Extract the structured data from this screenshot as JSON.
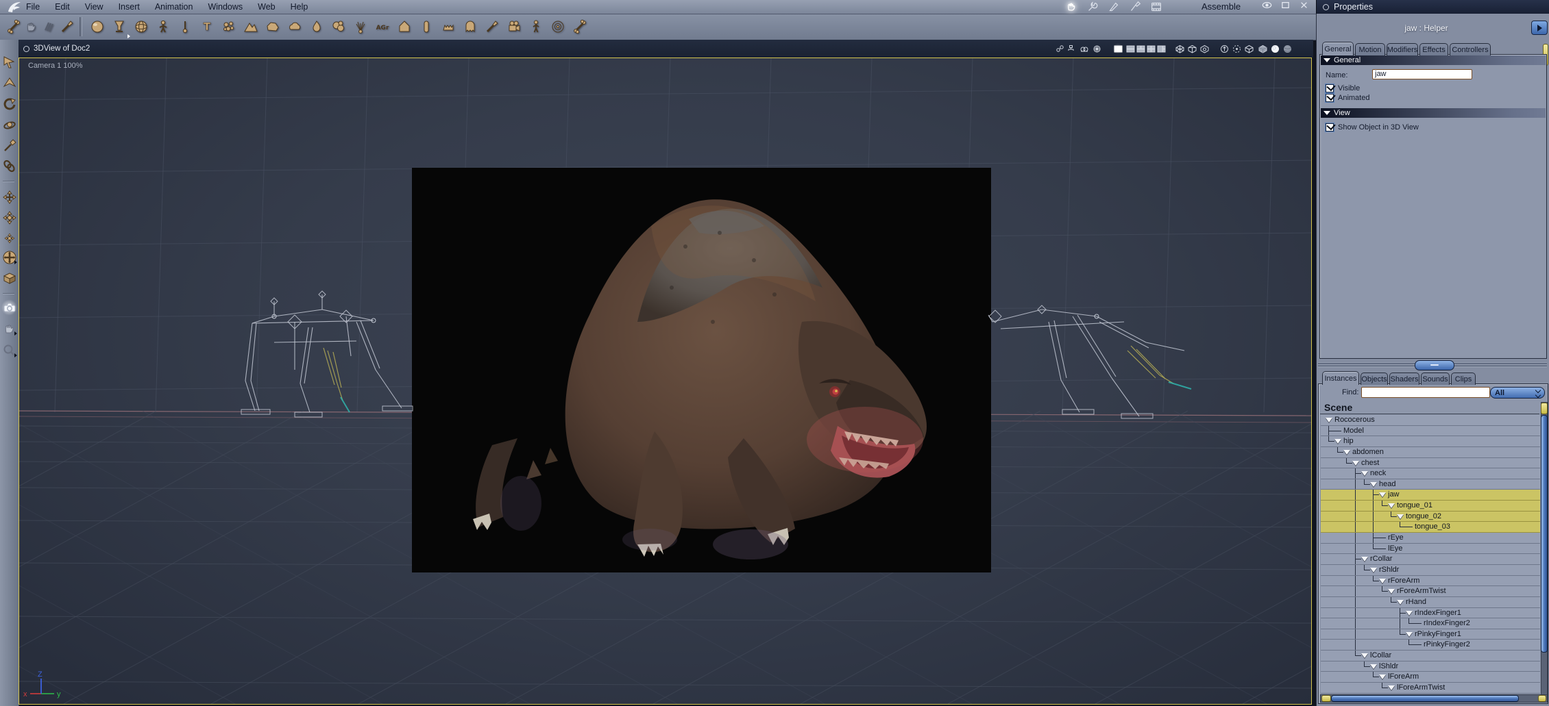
{
  "menubar": {
    "items": [
      "File",
      "Edit",
      "View",
      "Insert",
      "Animation",
      "Windows",
      "Web",
      "Help"
    ],
    "mode_label": "Assemble",
    "mode_icons": [
      "hand-mode-icon",
      "wrench-mode-icon",
      "vertex-pen-mode-icon",
      "brush-mode-icon",
      "film-mode-icon"
    ],
    "active_mode_icon": 0,
    "window_icons": [
      "eye-icon",
      "maximize-icon",
      "close-icon"
    ]
  },
  "toolbar": {
    "group1": [
      {
        "name": "skinning-tool",
        "shape": "boneshape",
        "gray": false
      },
      {
        "name": "hand-tool",
        "shape": "hand",
        "gray": true
      },
      {
        "name": "ik-fingers-tool",
        "shape": "fingers",
        "gray": true
      },
      {
        "name": "paint-3d-tool",
        "shape": "brush",
        "gray": false
      }
    ],
    "group2": [
      {
        "name": "insert-sphere-tool",
        "shape": "ball"
      },
      {
        "name": "insert-vertex-object-tool",
        "shape": "goblet"
      },
      {
        "name": "insert-globe-tool",
        "shape": "globe"
      },
      {
        "name": "insert-skeleton-tool",
        "shape": "figure"
      },
      {
        "name": "insert-spline-object-tool",
        "shape": "pin"
      },
      {
        "name": "insert-text-tool",
        "shape": "tee"
      },
      {
        "name": "insert-particles-tool",
        "shape": "dots"
      },
      {
        "name": "insert-terrain-tool",
        "shape": "mountain"
      },
      {
        "name": "insert-rock-tool",
        "shape": "rock"
      },
      {
        "name": "insert-cloud-tool",
        "shape": "cloud"
      },
      {
        "name": "insert-fire-tool",
        "shape": "flame"
      },
      {
        "name": "insert-metaballs-tool",
        "shape": "blobs"
      },
      {
        "name": "insert-fountain-tool",
        "shape": "fountain"
      },
      {
        "name": "insert-autogroup-tool",
        "shape": "agr"
      },
      {
        "name": "insert-cone-tool",
        "shape": "house"
      },
      {
        "name": "insert-capsule-tool",
        "shape": "capsule"
      },
      {
        "name": "insert-denture-tool",
        "shape": "comb"
      },
      {
        "name": "insert-ghost-tool",
        "shape": "ghost"
      },
      {
        "name": "insert-spray-tool",
        "shape": "brush"
      },
      {
        "name": "insert-camera-tool",
        "shape": "filmcam"
      },
      {
        "name": "insert-figure-tool",
        "shape": "person"
      },
      {
        "name": "insert-target-tool",
        "shape": "target"
      },
      {
        "name": "insert-bone-tool",
        "shape": "boneshape"
      }
    ]
  },
  "left_toolbar": [
    {
      "name": "select-tool",
      "shape": "selarrow"
    },
    {
      "name": "move-tool",
      "shape": "pyramid"
    },
    {
      "name": "rotate-tool",
      "shape": "rotarrow"
    },
    {
      "name": "scale-tool",
      "shape": "ringball"
    },
    {
      "name": "eyedropper-tool",
      "shape": "dropper"
    },
    {
      "name": "link-tool",
      "shape": "chain"
    },
    {
      "name": "sep",
      "shape": "sep"
    },
    {
      "name": "pan-xyz-tool",
      "shape": "cross4"
    },
    {
      "name": "pan-plane-tool",
      "shape": "cross4ball"
    },
    {
      "name": "pan-small-tool",
      "shape": "cross4small"
    },
    {
      "name": "trackball-tool",
      "shape": "trackball",
      "flyout": true
    },
    {
      "name": "working-box-tool",
      "shape": "wbox"
    },
    {
      "name": "sep2",
      "shape": "sep"
    },
    {
      "name": "camera-pan-tool",
      "shape": "camera",
      "glow": true
    },
    {
      "name": "hand-pan-tool",
      "shape": "hand",
      "flyout": true
    },
    {
      "name": "zoom-tool",
      "shape": "magnify",
      "flyout": true
    }
  ],
  "viewport": {
    "title": "3DView of Doc2",
    "camera_label": "Camera 1 100%",
    "axis_labels": {
      "x": "x",
      "y": "y",
      "z": "Z"
    },
    "title_icons": [
      "interpolation-icon",
      "hierarchy-icon",
      "camera-track-icon",
      "caged-sphere-icon",
      "layout-single-icon",
      "layout-2pane-icon",
      "layout-3pane-icon",
      "layout-4pane-icon",
      "layout-custom-icon",
      "working-box-a-icon",
      "working-box-b-icon",
      "working-box-c-icon",
      "send-origin-icon",
      "bounding-sphere-icon",
      "wireframe-cube-icon",
      "solid-cube-icon",
      "lit-sphere-icon",
      "textured-sphere-icon"
    ],
    "active_title_icon": 4
  },
  "properties": {
    "title": "Properties",
    "object_header": "jaw : Helper",
    "tabs": [
      "General",
      "Motion",
      "Modifiers",
      "Effects",
      "Controllers"
    ],
    "active_tab": 0,
    "general_section": {
      "label": "General",
      "name_label": "Name:",
      "name_value": "jaw",
      "checkboxes": [
        {
          "label": "Visible",
          "checked": true
        },
        {
          "label": "Animated",
          "checked": true
        }
      ]
    },
    "view_section": {
      "label": "View",
      "checkboxes": [
        {
          "label": "Show Object in 3D View",
          "checked": true
        }
      ]
    }
  },
  "browser": {
    "tabs": [
      "Instances",
      "Objects",
      "Shaders",
      "Sounds",
      "Clips"
    ],
    "active_tab": 0,
    "find_label": "Find:",
    "find_value": "",
    "filter_value": "All",
    "scene_label": "Scene",
    "tree": [
      {
        "label": "Rococerous",
        "depth": 0,
        "arrow": true,
        "selected": false
      },
      {
        "label": "Model",
        "depth": 1,
        "arrow": false,
        "selected": false
      },
      {
        "label": "hip",
        "depth": 1,
        "arrow": true,
        "selected": false
      },
      {
        "label": "abdomen",
        "depth": 2,
        "arrow": true,
        "selected": false
      },
      {
        "label": "chest",
        "depth": 3,
        "arrow": true,
        "selected": false
      },
      {
        "label": "neck",
        "depth": 4,
        "arrow": true,
        "selected": false
      },
      {
        "label": "head",
        "depth": 5,
        "arrow": true,
        "selected": false
      },
      {
        "label": "jaw",
        "depth": 6,
        "arrow": true,
        "selected": true
      },
      {
        "label": "tongue_01",
        "depth": 7,
        "arrow": true,
        "selected": true
      },
      {
        "label": "tongue_02",
        "depth": 8,
        "arrow": true,
        "selected": true
      },
      {
        "label": "tongue_03",
        "depth": 9,
        "arrow": false,
        "selected": true
      },
      {
        "label": "rEye",
        "depth": 6,
        "arrow": false,
        "selected": false
      },
      {
        "label": "lEye",
        "depth": 6,
        "arrow": false,
        "selected": false
      },
      {
        "label": "rCollar",
        "depth": 4,
        "arrow": true,
        "selected": false
      },
      {
        "label": "rShldr",
        "depth": 5,
        "arrow": true,
        "selected": false
      },
      {
        "label": "rForeArm",
        "depth": 6,
        "arrow": true,
        "selected": false
      },
      {
        "label": "rForeArmTwist",
        "depth": 7,
        "arrow": true,
        "selected": false
      },
      {
        "label": "rHand",
        "depth": 8,
        "arrow": true,
        "selected": false
      },
      {
        "label": "rIndexFinger1",
        "depth": 9,
        "arrow": true,
        "selected": false
      },
      {
        "label": "rIndexFinger2",
        "depth": 10,
        "arrow": false,
        "selected": false
      },
      {
        "label": "rPinkyFinger1",
        "depth": 9,
        "arrow": true,
        "selected": false
      },
      {
        "label": "rPinkyFinger2",
        "depth": 10,
        "arrow": false,
        "selected": false
      },
      {
        "label": "lCollar",
        "depth": 4,
        "arrow": true,
        "selected": false
      },
      {
        "label": "lShldr",
        "depth": 5,
        "arrow": true,
        "selected": false
      },
      {
        "label": "lForeArm",
        "depth": 6,
        "arrow": true,
        "selected": false
      },
      {
        "label": "lForeArmTwist",
        "depth": 7,
        "arrow": true,
        "selected": false
      }
    ]
  },
  "colors": {
    "selection_yellow": "#cbc464",
    "panel_gray": "#8e97ab",
    "titlebar_navy": "#1d2434",
    "accent_blue": "#4a74b8",
    "viewport_bg": "#353c4b",
    "active_border_yellow": "#d5c54e"
  }
}
